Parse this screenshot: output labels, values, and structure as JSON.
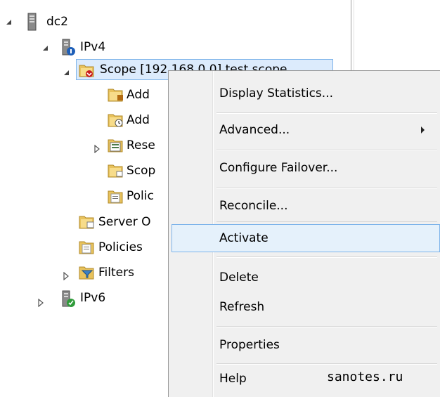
{
  "tree": {
    "root": {
      "label": "dc2",
      "icon": "server-icon"
    },
    "ipv4": {
      "label": "IPv4",
      "icon": "ipv4-server-icon"
    },
    "scope": {
      "label": "Scope [192.168.0.0] test scope",
      "icon": "scope-folder-icon"
    },
    "children": [
      {
        "label": "Add",
        "icon": "address-pool-icon"
      },
      {
        "label": "Add",
        "icon": "address-leases-icon"
      },
      {
        "label": "Rese",
        "icon": "reservations-icon"
      },
      {
        "label": "Scop",
        "icon": "scope-options-icon"
      },
      {
        "label": "Polic",
        "icon": "policies-icon"
      }
    ],
    "ipv4_items": [
      {
        "label": "Server O",
        "icon": "server-options-icon"
      },
      {
        "label": "Policies",
        "icon": "policies-icon"
      },
      {
        "label": "Filters",
        "icon": "filters-icon"
      }
    ],
    "ipv6": {
      "label": "IPv6",
      "icon": "ipv6-server-icon"
    }
  },
  "context_menu": {
    "items": [
      {
        "label": "Display Statistics..."
      },
      {
        "label": "Advanced...",
        "submenu": true
      },
      {
        "label": "Configure Failover..."
      },
      {
        "label": "Reconcile..."
      },
      {
        "label": "Activate",
        "highlighted": true
      },
      {
        "label": "Delete"
      },
      {
        "label": "Refresh"
      },
      {
        "label": "Properties"
      },
      {
        "label": "Help"
      }
    ]
  },
  "watermark": "sanotes.ru",
  "colors": {
    "selection_fill": "#dcebfc",
    "selection_border": "#7eb4ea",
    "menu_bg": "#f0f0f0"
  }
}
